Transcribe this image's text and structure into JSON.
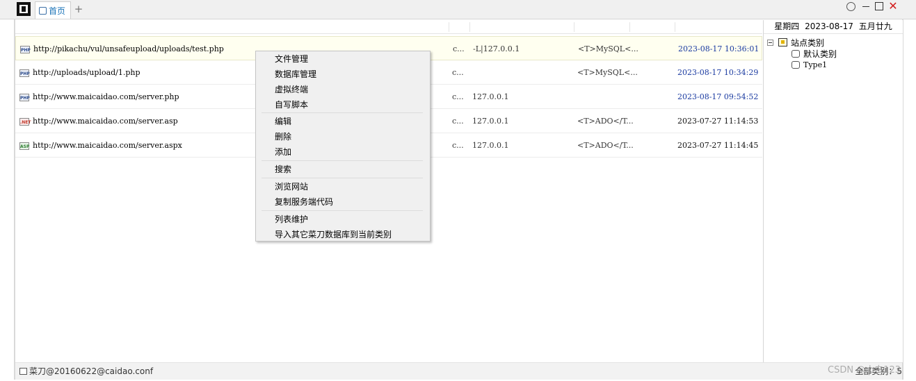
{
  "titlebar": {
    "tab_home_label": "首页",
    "tab_add_label": "+",
    "close_glyph": "✕"
  },
  "grid": {
    "rows": [
      {
        "type_badge": "PHP",
        "url": "http://pikachu/vul/unsafeupload/uploads/test.php",
        "col_a": "c...",
        "col_b": "-L|127.0.0.1",
        "col_c": "<T>MySQL<...",
        "time": "2023-08-17 10:36:01",
        "time_color": "blue"
      },
      {
        "type_badge": "PHP",
        "url": "http://uploads/upload/1.php",
        "col_a": "c...",
        "col_b": "",
        "col_c": "<T>MySQL<...",
        "time": "2023-08-17 10:34:29",
        "time_color": "blue"
      },
      {
        "type_badge": "PHP",
        "url": "http://www.maicaidao.com/server.php",
        "col_a": "c...",
        "col_b": "127.0.0.1",
        "col_c": "",
        "time": "2023-08-17 09:54:52",
        "time_color": "blue"
      },
      {
        "type_badge": ".NET",
        "url": "http://www.maicaidao.com/server.asp",
        "col_a": "c...",
        "col_b": "127.0.0.1",
        "col_c": "<T>ADO</T...",
        "time": "2023-07-27 11:14:53",
        "time_color": "black"
      },
      {
        "type_badge": "ASP",
        "url": "http://www.maicaidao.com/server.aspx",
        "col_a": "c...",
        "col_b": "127.0.0.1",
        "col_c": "<T>ADO</T...",
        "time": "2023-07-27 11:14:45",
        "time_color": "black"
      }
    ]
  },
  "right_pane": {
    "weekday": "星期四",
    "date": "2023-08-17",
    "lunar_date": "五月廿九",
    "tree_root": "站点类别",
    "tree_children": [
      "默认类别",
      "Type1"
    ]
  },
  "context_menu": {
    "groups": [
      [
        "文件管理",
        "数据库管理",
        "虚拟终端",
        "自写脚本"
      ],
      [
        "编辑",
        "删除",
        "添加"
      ],
      [
        "搜索"
      ],
      [
        "浏览网站",
        "复制服务端代码"
      ],
      [
        "列表维护",
        "导入其它菜刀数据库到当前类别"
      ]
    ]
  },
  "statusbar": {
    "left_text": "菜刀@20160622@caidao.conf",
    "right_text": "全部类别：5",
    "watermark": "CSDN @小白123"
  }
}
